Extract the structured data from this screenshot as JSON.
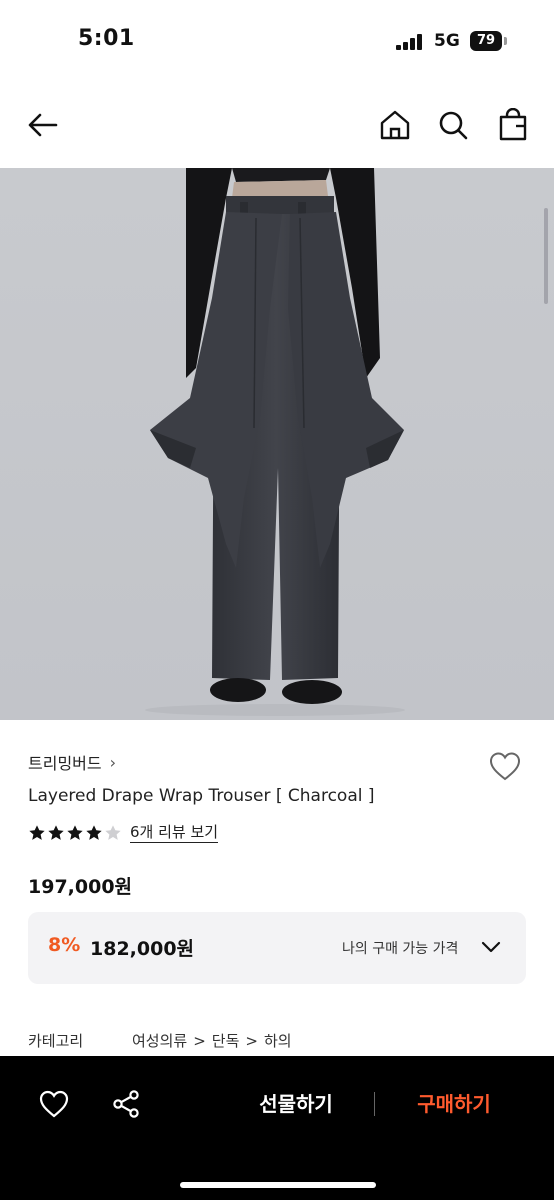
{
  "status": {
    "time": "5:01",
    "network": "5G",
    "battery": "79"
  },
  "nav": {
    "back_icon": "arrow-left-icon",
    "home_icon": "home-icon",
    "search_icon": "search-icon",
    "bag_icon": "shopping-bag-icon"
  },
  "product": {
    "brand": "트리밍버드",
    "brand_chevron": "›",
    "name": "Layered Drape Wrap Trouser [ Charcoal ]",
    "rating_stars": 4,
    "rating_max": 5,
    "review_link": "6개 리뷰 보기",
    "price": "197,000원",
    "my_price": {
      "discount": "8%",
      "price": "182,000원",
      "label": "나의 구매 가능 가격"
    },
    "category": {
      "label": "카테고리",
      "path": [
        "여성의류",
        "단독",
        "하의"
      ],
      "separator": ">"
    }
  },
  "bottom_bar": {
    "gift_label": "선물하기",
    "buy_label": "구매하기",
    "wish_icon": "heart-icon",
    "share_icon": "share-icon"
  },
  "colors": {
    "accent": "#f05a22",
    "buy": "#ff5b2e",
    "image_bg": "#c9cbd0",
    "trouser": "#3a3c43"
  }
}
